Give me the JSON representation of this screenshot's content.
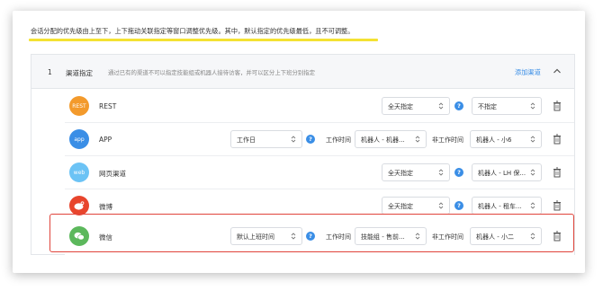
{
  "notice": "会话分配的优先级由上至下，上下拖动关联指定等窗口调整优先级。其中，默认指定的优先级最低，且不可调整。",
  "panel": {
    "index": "1",
    "title": "渠道指定",
    "description": "通过已有的渠道不可以指定技能组或机器人接待访客，并可以区分上下班分别指定",
    "add_label": "添加渠道"
  },
  "labels": {
    "work_time": "工作时间",
    "non_work_time": "非工作时间",
    "help": "?"
  },
  "rows": [
    {
      "icon_text": "REST",
      "icon_color": "#f39a2c",
      "name": "REST",
      "select_a": "全天指定",
      "select_b": "不指定"
    },
    {
      "icon_text": "app",
      "icon_color": "#3a8ee6",
      "name": "APP",
      "schedule": "工作日",
      "work": "机器人 - 机器...",
      "nonwork": "机器人 - 小6"
    },
    {
      "icon_text": "web",
      "icon_color": "#6cc3f5",
      "name": "网页渠道",
      "select_a": "全天指定",
      "select_b": "机器人 - LH 保..."
    },
    {
      "icon_text": "weibo-icon",
      "icon_color": "#e8452c",
      "name": "微博",
      "select_a": "全天指定",
      "select_b": "机器人 - 租车..."
    },
    {
      "icon_text": "wechat-icon",
      "icon_color": "#5cb85c",
      "name": "微信",
      "schedule": "默认上班时间",
      "work": "技能组 - 售前...",
      "nonwork": "机器人 - 小二"
    }
  ]
}
